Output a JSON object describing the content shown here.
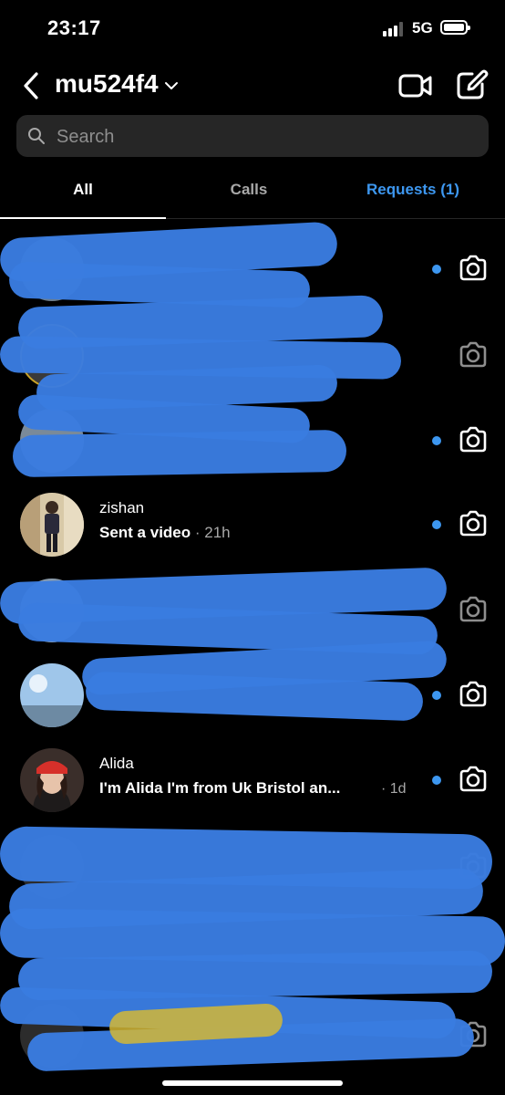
{
  "status_bar": {
    "time": "23:17",
    "network": "5G"
  },
  "header": {
    "account_name": "mu524f4",
    "icons": [
      "back-chevron-icon",
      "chevron-down-icon",
      "video-camera-icon",
      "compose-icon"
    ]
  },
  "search": {
    "placeholder": "Search"
  },
  "tabs": [
    {
      "label": "All",
      "active": true
    },
    {
      "label": "Calls",
      "active": false
    },
    {
      "label": "Requests (1)",
      "active": false
    }
  ],
  "conversations": [
    {
      "username": "",
      "preview": "",
      "redacted": true,
      "unread": true
    },
    {
      "username": "",
      "preview": "",
      "redacted": true,
      "unread": false
    },
    {
      "username": "",
      "preview": "",
      "redacted": true,
      "unread": true
    },
    {
      "username": "zishan",
      "preview": "Sent a video",
      "time": "· 21h",
      "redacted": false,
      "unread": true
    },
    {
      "username": "",
      "preview": "",
      "redacted": true,
      "unread": false
    },
    {
      "username": "",
      "preview": "",
      "redacted": true,
      "unread": true
    },
    {
      "username": "Alida",
      "preview": "I'm Alida  I'm from Uk Bristol  an...",
      "time": "· 1d",
      "redacted": false,
      "unread": true
    },
    {
      "username": "",
      "preview": "",
      "redacted": true,
      "unread": false
    },
    {
      "username": "",
      "preview": "",
      "redacted": true,
      "unread": false
    }
  ],
  "colors": {
    "background": "#000000",
    "accent_blue": "#3d97f0",
    "search_bg": "#262626",
    "secondary_text": "#a8a8a8",
    "redaction": "#3a7ce0"
  }
}
